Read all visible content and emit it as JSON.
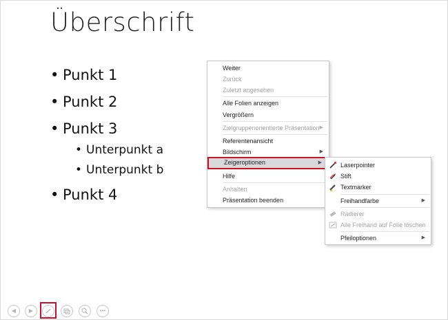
{
  "slide": {
    "title": "Überschrift",
    "bullets": [
      {
        "text": "Punkt 1",
        "sub": []
      },
      {
        "text": "Punkt 2",
        "sub": []
      },
      {
        "text": "Punkt 3",
        "sub": [
          "Unterpunkt a",
          "Unterpunkt b"
        ]
      },
      {
        "text": "Punkt 4",
        "sub": []
      }
    ]
  },
  "context_menu": {
    "items": [
      {
        "label": "Weiter",
        "disabled": false
      },
      {
        "label": "Zurück",
        "disabled": true
      },
      {
        "label": "Zuletzt angesehen",
        "disabled": true
      },
      {
        "label": "Alle Folien anzeigen",
        "disabled": false
      },
      {
        "label": "Vergrößern",
        "disabled": false
      },
      {
        "label": "Zielgruppenorientierte Präsentation",
        "disabled": true,
        "submenu": true
      },
      {
        "label": "Referentenansicht",
        "disabled": false
      },
      {
        "label": "Bildschirm",
        "disabled": false,
        "submenu": true
      },
      {
        "label": "Zeigeroptionen",
        "disabled": false,
        "submenu": true,
        "highlighted": true
      },
      {
        "label": "Hilfe",
        "disabled": false
      },
      {
        "label": "Anhalten",
        "disabled": true
      },
      {
        "label": "Präsentation beenden",
        "disabled": false
      }
    ]
  },
  "submenu": {
    "items": [
      {
        "label": "Laserpointer",
        "icon": "laser-pointer-icon",
        "disabled": false
      },
      {
        "label": "Stift",
        "icon": "pen-icon",
        "disabled": false
      },
      {
        "label": "Textmarker",
        "icon": "highlighter-icon",
        "disabled": false
      },
      {
        "label": "Freihandfarbe",
        "disabled": false,
        "submenu": true
      },
      {
        "label": "Radierer",
        "icon": "eraser-icon",
        "disabled": true
      },
      {
        "label": "Alle Freihand auf Folie löschen",
        "icon": "erase-all-icon",
        "disabled": true
      },
      {
        "label": "Pfeiloptionen",
        "disabled": false,
        "submenu": true
      }
    ]
  },
  "navbar": {
    "buttons": [
      "previous-icon",
      "next-icon",
      "pen-icon",
      "slides-icon",
      "zoom-icon",
      "more-icon"
    ],
    "highlighted": "pen-icon"
  },
  "colors": {
    "highlight_border": "#c8102e",
    "menu_highlight_bg": "#d9d9d9",
    "disabled_text": "#a6a6a6"
  }
}
